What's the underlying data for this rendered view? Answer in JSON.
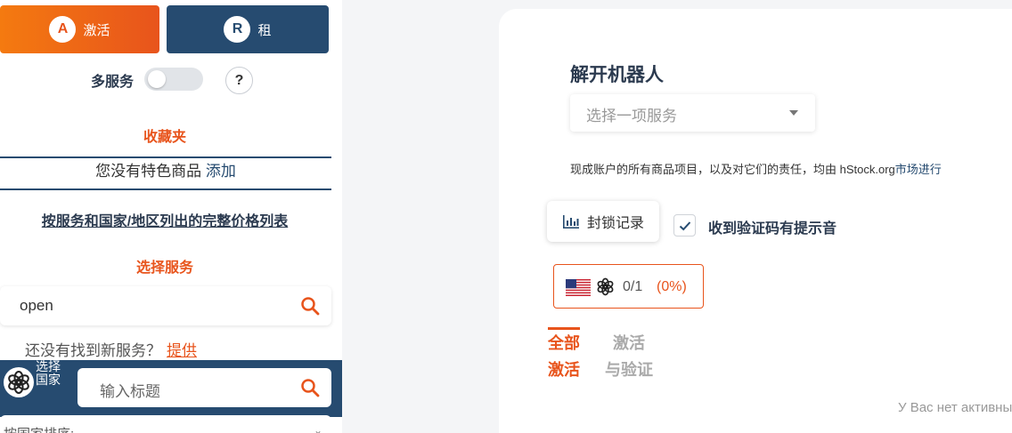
{
  "sidebar": {
    "tabs": {
      "activate": {
        "label": "激活",
        "logo": "A"
      },
      "rent": {
        "label": "租",
        "logo": "R"
      }
    },
    "multi_service_label": "多服务",
    "help_label": "?",
    "favorites_title": "收藏夹",
    "favorites_empty": "您没有特色商品",
    "favorites_add": "添加",
    "price_list_link": "按服务和国家/地区列出的完整价格列表",
    "select_service_title": "选择服务",
    "search_value": "open",
    "not_found_text": "还没有找到新服务？",
    "suggest_link": "提供",
    "country_label": "选择国家",
    "country_placeholder": "输入标题",
    "sort_label": "按国家排序:"
  },
  "main": {
    "title": "解开机器人",
    "service_placeholder": "选择一项服务",
    "disclaimer": "现成账户的所有商品项目，以及对它们的责任，均由 hStock.org",
    "disclaimer_link": "市场进行",
    "block_log_label": "封锁记录",
    "sound_label": "收到验证码有提示音",
    "chip": {
      "count": "0/1",
      "percent": "(0%)"
    },
    "filters": {
      "all": "全部\n激活",
      "activate": "激活\n与验证"
    },
    "no_data": "У Вас нет активных"
  },
  "colors": {
    "accent": "#e8541c",
    "navy": "#264b70"
  }
}
